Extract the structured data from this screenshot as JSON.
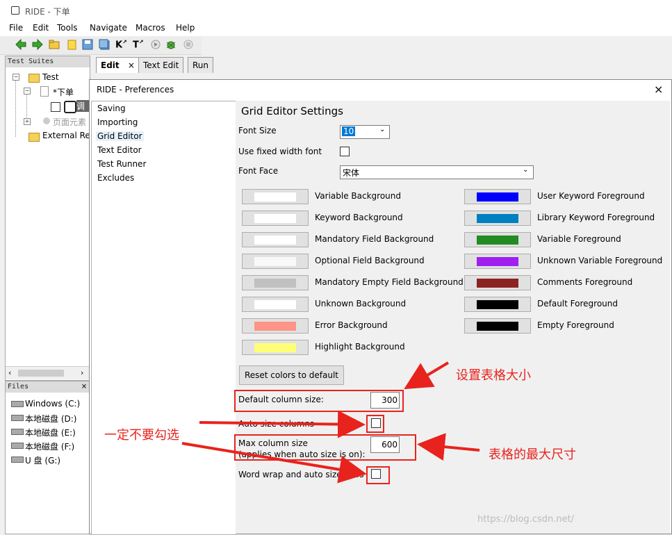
{
  "window": {
    "title": "RIDE - 下单"
  },
  "menu": [
    "File",
    "Edit",
    "Tools",
    "Navigate",
    "Macros",
    "Help"
  ],
  "toolbar_icons": [
    "back-arrow-icon",
    "forward-arrow-icon",
    "open-folder-icon",
    "folder-icon",
    "save-icon",
    "save-all-icon",
    "search-keyword-icon",
    "search-test-icon",
    "run-icon",
    "stop-icon",
    "debug-icon"
  ],
  "test_suites": {
    "title": "Test Suites",
    "items": [
      "Test",
      "*下单",
      "调",
      "页面元素",
      "External Res"
    ]
  },
  "files": {
    "title": "Files",
    "close": "×",
    "drives": [
      "Windows (C:)",
      "本地磁盘 (D:)",
      "本地磁盘 (E:)",
      "本地磁盘 (F:)",
      "U 盘 (G:)"
    ]
  },
  "tabs": [
    {
      "label": "Edit",
      "active": true,
      "close": "×"
    },
    {
      "label": "Text Edit"
    },
    {
      "label": "Run"
    }
  ],
  "dialog": {
    "title": "RIDE - Preferences",
    "close": "×",
    "categories": [
      "Saving",
      "Importing",
      "Grid Editor",
      "Text Editor",
      "Test Runner",
      "Excludes"
    ],
    "selected_category": "Grid Editor",
    "heading": "Grid Editor Settings",
    "font_size_label": "Font Size",
    "font_size_value": "10",
    "fixed_width_label": "Use fixed width font",
    "font_face_label": "Font Face",
    "font_face_value": "宋体",
    "colors_left": [
      {
        "label": "Variable Background",
        "color": "#ffffff"
      },
      {
        "label": "Keyword Background",
        "color": "#ffffff"
      },
      {
        "label": "Mandatory Field Background",
        "color": "#ffffff"
      },
      {
        "label": "Optional Field Background",
        "color": "#f8f8f8"
      },
      {
        "label": "Mandatory Empty Field Background",
        "color": "#c0c0c0"
      },
      {
        "label": "Unknown Background",
        "color": "#ffffff"
      },
      {
        "label": "Error Background",
        "color": "#ff9488"
      },
      {
        "label": "Highlight Background",
        "color": "#ffff77"
      }
    ],
    "colors_right": [
      {
        "label": "User Keyword Foreground",
        "color": "#0000ff"
      },
      {
        "label": "Library Keyword Foreground",
        "color": "#0080c0"
      },
      {
        "label": "Variable Foreground",
        "color": "#228b22"
      },
      {
        "label": "Unknown Variable Foreground",
        "color": "#a020f0"
      },
      {
        "label": "Comments Foreground",
        "color": "#8b2323"
      },
      {
        "label": "Default Foreground",
        "color": "#000000"
      },
      {
        "label": "Empty Foreground",
        "color": "#000000"
      }
    ],
    "reset_label": "Reset colors to default",
    "default_col_label": "Default column size:",
    "default_col_value": "300",
    "auto_size_label": "Auto size columns",
    "max_col_label_1": "Max column size",
    "max_col_label_2": "(applies when auto size is on):",
    "max_col_value": "600",
    "word_wrap_label": "Word wrap and auto size rows"
  },
  "annotations": {
    "table_size": "设置表格大小",
    "do_not_check": "一定不要勾选",
    "max_size": "表格的最大尺寸",
    "color": "#e8231d"
  },
  "watermark": "https://blog.csdn.net/"
}
